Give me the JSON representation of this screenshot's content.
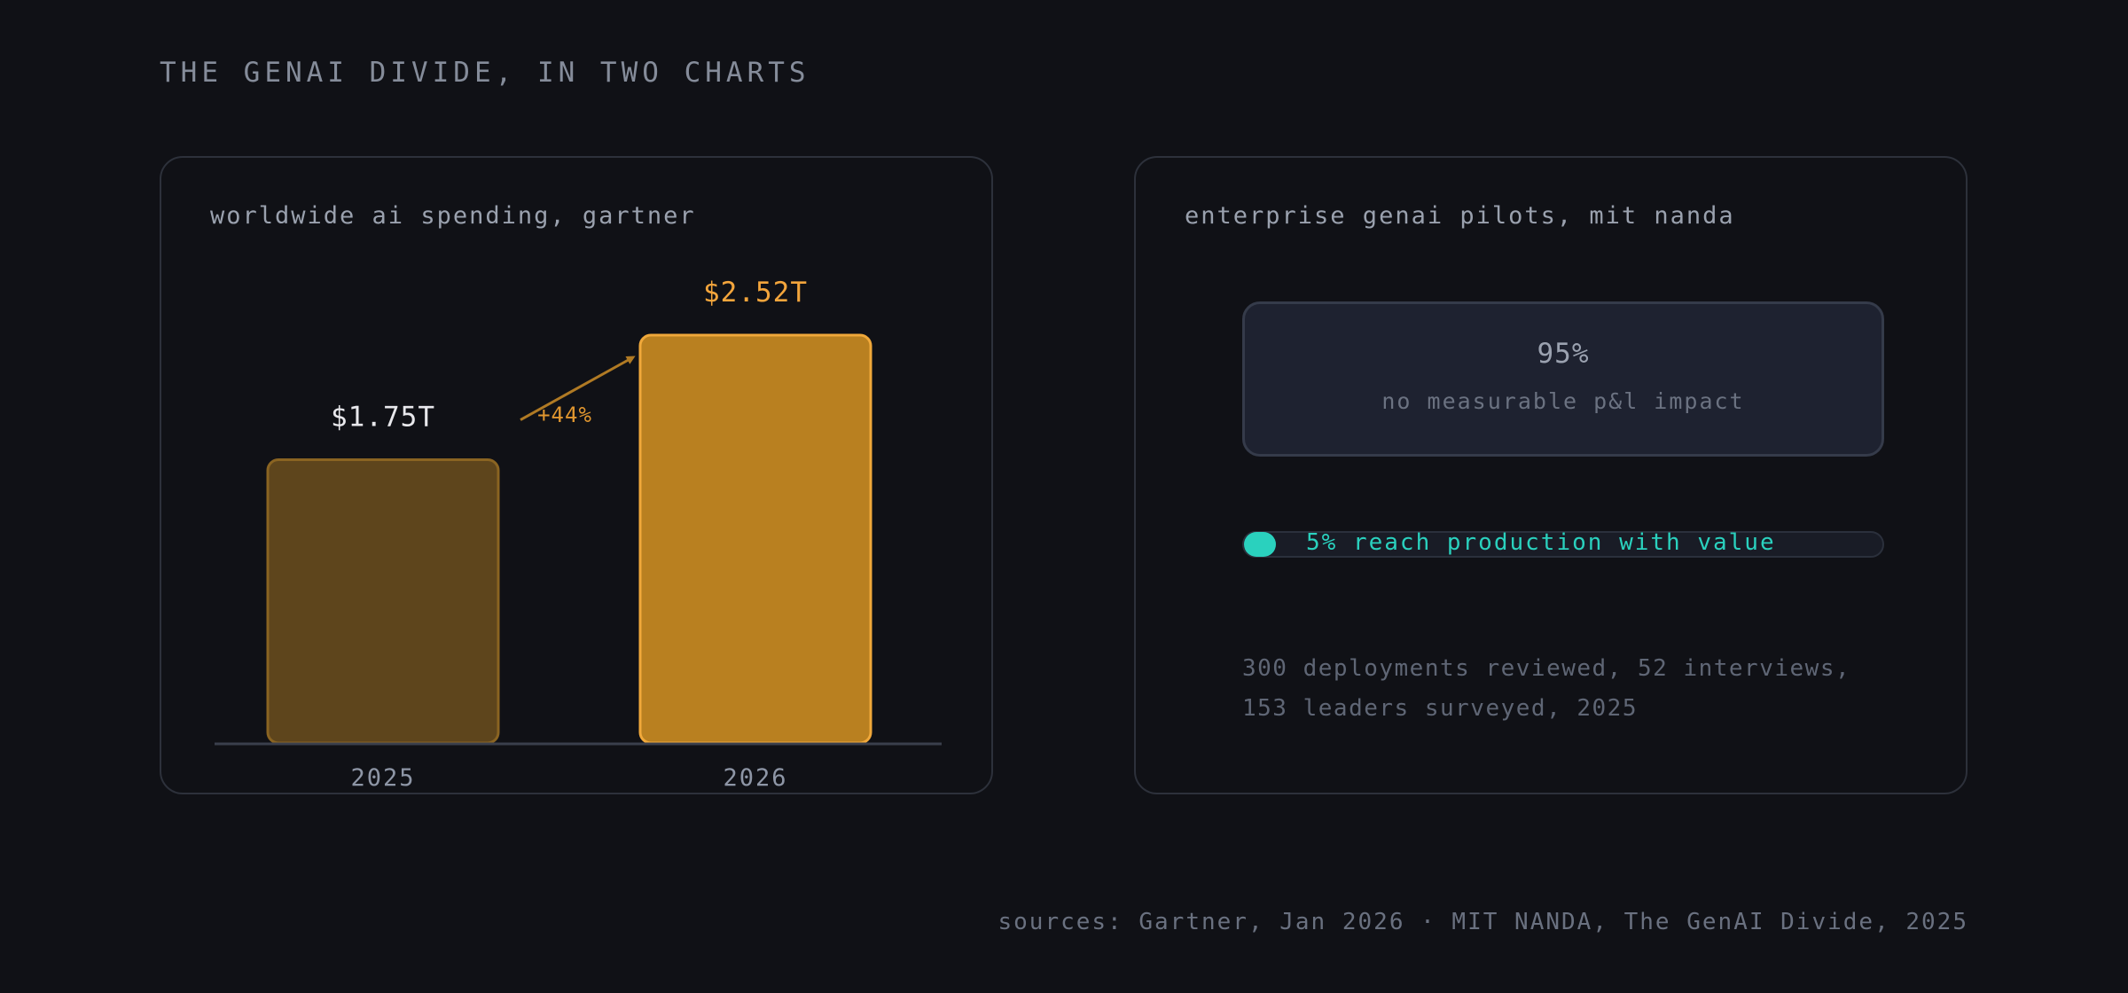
{
  "page": {
    "title": "THE GENAI DIVIDE, IN TWO CHARTS",
    "sources": "sources: Gartner, Jan 2026 · MIT NANDA, The GenAI Divide, 2025"
  },
  "spending": {
    "title": "worldwide ai spending, gartner",
    "growth_label": "+44%"
  },
  "pilots": {
    "title": "enterprise genai pilots, mit nanda",
    "no_impact_value": "95%",
    "no_impact_label": "no measurable p&l impact",
    "production_fraction": 0.05,
    "production_label": "5% reach production with value",
    "note_line1": "300 deployments reviewed, 52 interviews,",
    "note_line2": "153 leaders surveyed, 2025"
  },
  "chart_data": [
    {
      "type": "bar",
      "title": "worldwide ai spending, gartner",
      "categories": [
        "2025",
        "2026"
      ],
      "values": [
        1.75,
        2.52
      ],
      "value_labels": [
        "$1.75T",
        "$2.52T"
      ],
      "ylim": [
        0,
        2.52
      ],
      "annotation": "+44%",
      "grid": false,
      "colors": {
        "2025": "#5e451c",
        "2026": "#b98020",
        "label_2025": "#e8e8ec",
        "label_2026": "#f3a53c",
        "arrow": "#b07a24"
      }
    },
    {
      "type": "table",
      "title": "enterprise genai pilots, mit nanda",
      "rows": [
        {
          "label": "no measurable p&l impact",
          "value": 95
        },
        {
          "label": "reach production with value",
          "value": 5
        }
      ],
      "colors": {
        "production": "#2ad1be"
      }
    }
  ]
}
